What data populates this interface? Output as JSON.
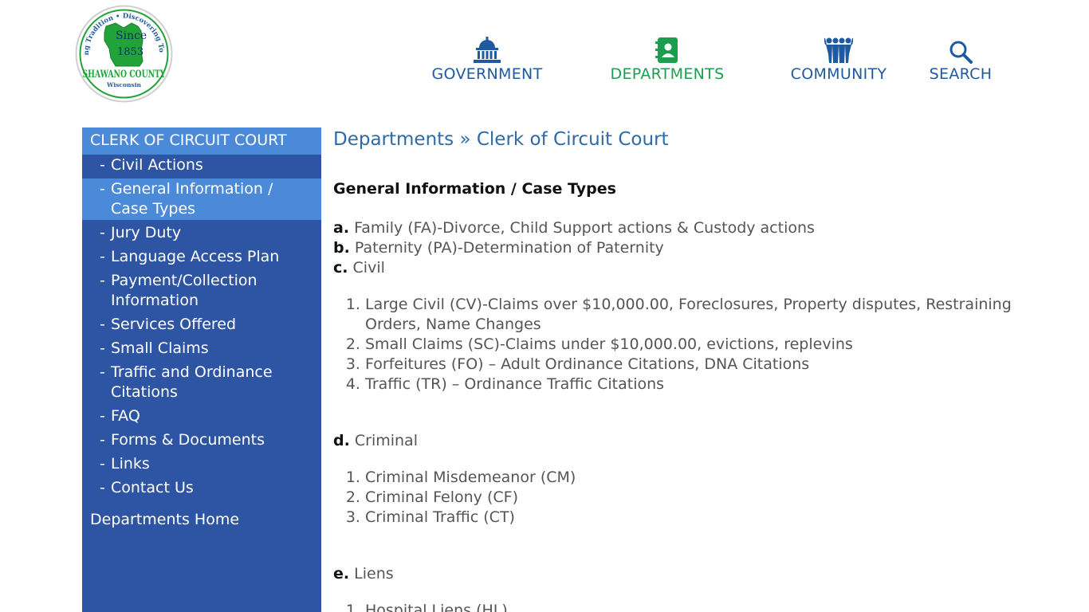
{
  "colors": {
    "nav_blue": "#1f5aa0",
    "nav_active_green": "#1b9f4e",
    "sidebar_bg": "#2e55a4",
    "sidebar_active_bg": "#4b8ad8",
    "breadcrumb_blue": "#2d6aa8",
    "logo_green": "#22a33a"
  },
  "logo": {
    "top_text": "Honoring Tradition • Discovering Tomorrow",
    "since": "Since",
    "year": "1853",
    "name": "SHAWANO COUNTY",
    "state": "Wisconsin"
  },
  "nav": {
    "government": {
      "label": "GOVERNMENT",
      "icon": "capitol-building-icon"
    },
    "departments": {
      "label": "DEPARTMENTS",
      "icon": "address-book-icon"
    },
    "community": {
      "label": "COMMUNITY",
      "icon": "people-group-icon"
    },
    "search": {
      "label": "SEARCH",
      "icon": "magnifier-icon"
    }
  },
  "sidebar": {
    "title": "CLERK OF CIRCUIT COURT",
    "dash": "-",
    "items": [
      {
        "label": "Civil Actions"
      },
      {
        "label": "General Information / Case Types"
      },
      {
        "label": "Jury Duty"
      },
      {
        "label": "Language Access Plan"
      },
      {
        "label": "Payment/Collection Information"
      },
      {
        "label": "Services Offered"
      },
      {
        "label": "Small Claims"
      },
      {
        "label": "Traffic and Ordinance Citations"
      },
      {
        "label": "FAQ"
      },
      {
        "label": "Forms & Documents"
      },
      {
        "label": "Links"
      },
      {
        "label": "Contact Us"
      }
    ],
    "home": "Departments Home"
  },
  "main": {
    "breadcrumb": "Departments » Clerk of Circuit Court",
    "title": "General Information / Case Types",
    "a": {
      "letter": "a.",
      "text": "Family (FA)-Divorce, Child Support actions & Custody actions"
    },
    "b": {
      "letter": "b.",
      "text": "Paternity (PA)-Determination of Paternity"
    },
    "c": {
      "letter": "c.",
      "text": "Civil",
      "items": [
        "Large Civil (CV)-Claims over $10,000.00, Foreclosures, Property disputes, Restraining Orders, Name Changes",
        "Small Claims (SC)-Claims under $10,000.00, evictions, replevins",
        "Forfeitures (FO) – Adult Ordinance Citations, DNA Citations",
        "Traffic (TR) – Ordinance Traffic Citations"
      ]
    },
    "d": {
      "letter": "d.",
      "text": "Criminal",
      "items": [
        "Criminal Misdemeanor (CM)",
        "Criminal Felony (CF)",
        "Criminal Traffic (CT)"
      ]
    },
    "e": {
      "letter": "e.",
      "text": "Liens",
      "items": [
        "Hospital Liens (HL)"
      ]
    }
  }
}
